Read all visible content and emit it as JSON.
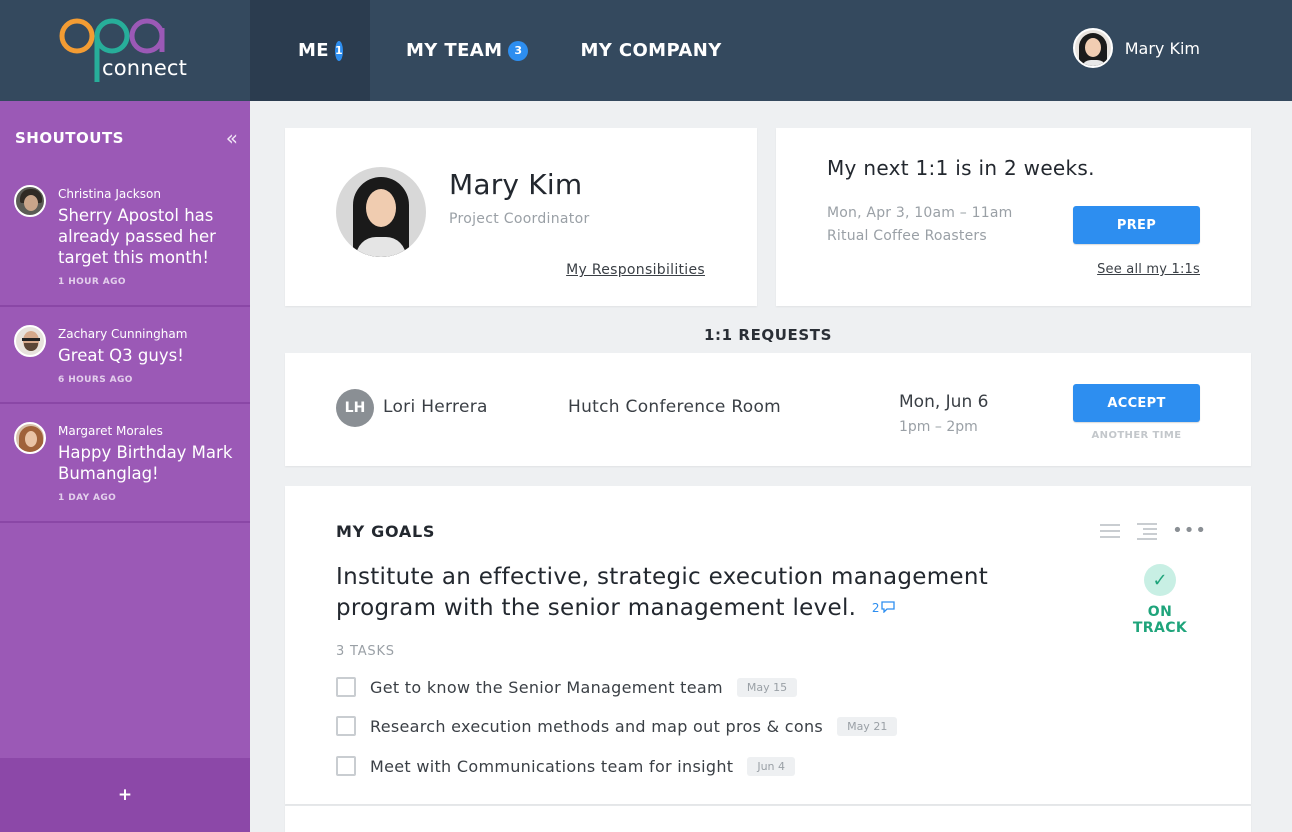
{
  "app": {
    "logo_text": "opa",
    "logo_subtext": "connect",
    "colors": {
      "header": "#34495e",
      "sidebar": "#9b59b6",
      "accent": "#2d8ef0",
      "on_track": "#1fa47b"
    }
  },
  "nav": {
    "tabs": [
      {
        "label": "ME",
        "badge": "1",
        "active": true
      },
      {
        "label": "MY TEAM",
        "badge": "3",
        "active": false
      },
      {
        "label": "MY COMPANY",
        "badge": "",
        "active": false
      }
    ],
    "user_name": "Mary Kim"
  },
  "sidebar": {
    "title": "SHOUTOUTS",
    "collapse_icon": "double-chevron-left-icon",
    "items": [
      {
        "author": "Christina Jackson",
        "message": "Sherry Apostol has already passed her target this month!",
        "time": "1 HOUR AGO"
      },
      {
        "author": "Zachary Cunningham",
        "message": "Great Q3 guys!",
        "time": "6 HOURS AGO"
      },
      {
        "author": "Margaret Morales",
        "message": "Happy Birthday Mark Bumanglag!",
        "time": "1 DAY AGO"
      }
    ],
    "add_label": "+"
  },
  "profile": {
    "name": "Mary Kim",
    "role": "Project Coordinator",
    "link": "My Responsibilities"
  },
  "next_one_on_one": {
    "title": "My next 1:1 is in 2 weeks.",
    "date": "Mon, Apr 3, 10am – 11am",
    "place": "Ritual Coffee Roasters",
    "button": "PREP",
    "link": "See all my 1:1s"
  },
  "requests": {
    "section_title": "1:1 REQUESTS",
    "items": [
      {
        "initials": "LH",
        "name": "Lori Herrera",
        "room": "Hutch Conference Room",
        "day": "Mon, Jun 6",
        "time": "1pm – 2pm",
        "accept": "ACCEPT",
        "another": "ANOTHER TIME"
      }
    ]
  },
  "goals": {
    "title": "MY GOALS",
    "goal_text": "Institute an effective, strategic execution management program with the senior management level.",
    "comment_count": "2",
    "status": "ON TRACK",
    "tasks_label": "3 TASKS",
    "tasks": [
      {
        "text": "Get to know the Senior Management team",
        "date": "May 15"
      },
      {
        "text": "Research execution methods and map out pros & cons",
        "date": "May 21"
      },
      {
        "text": "Meet with Communications team for insight",
        "date": "Jun 4"
      }
    ]
  }
}
